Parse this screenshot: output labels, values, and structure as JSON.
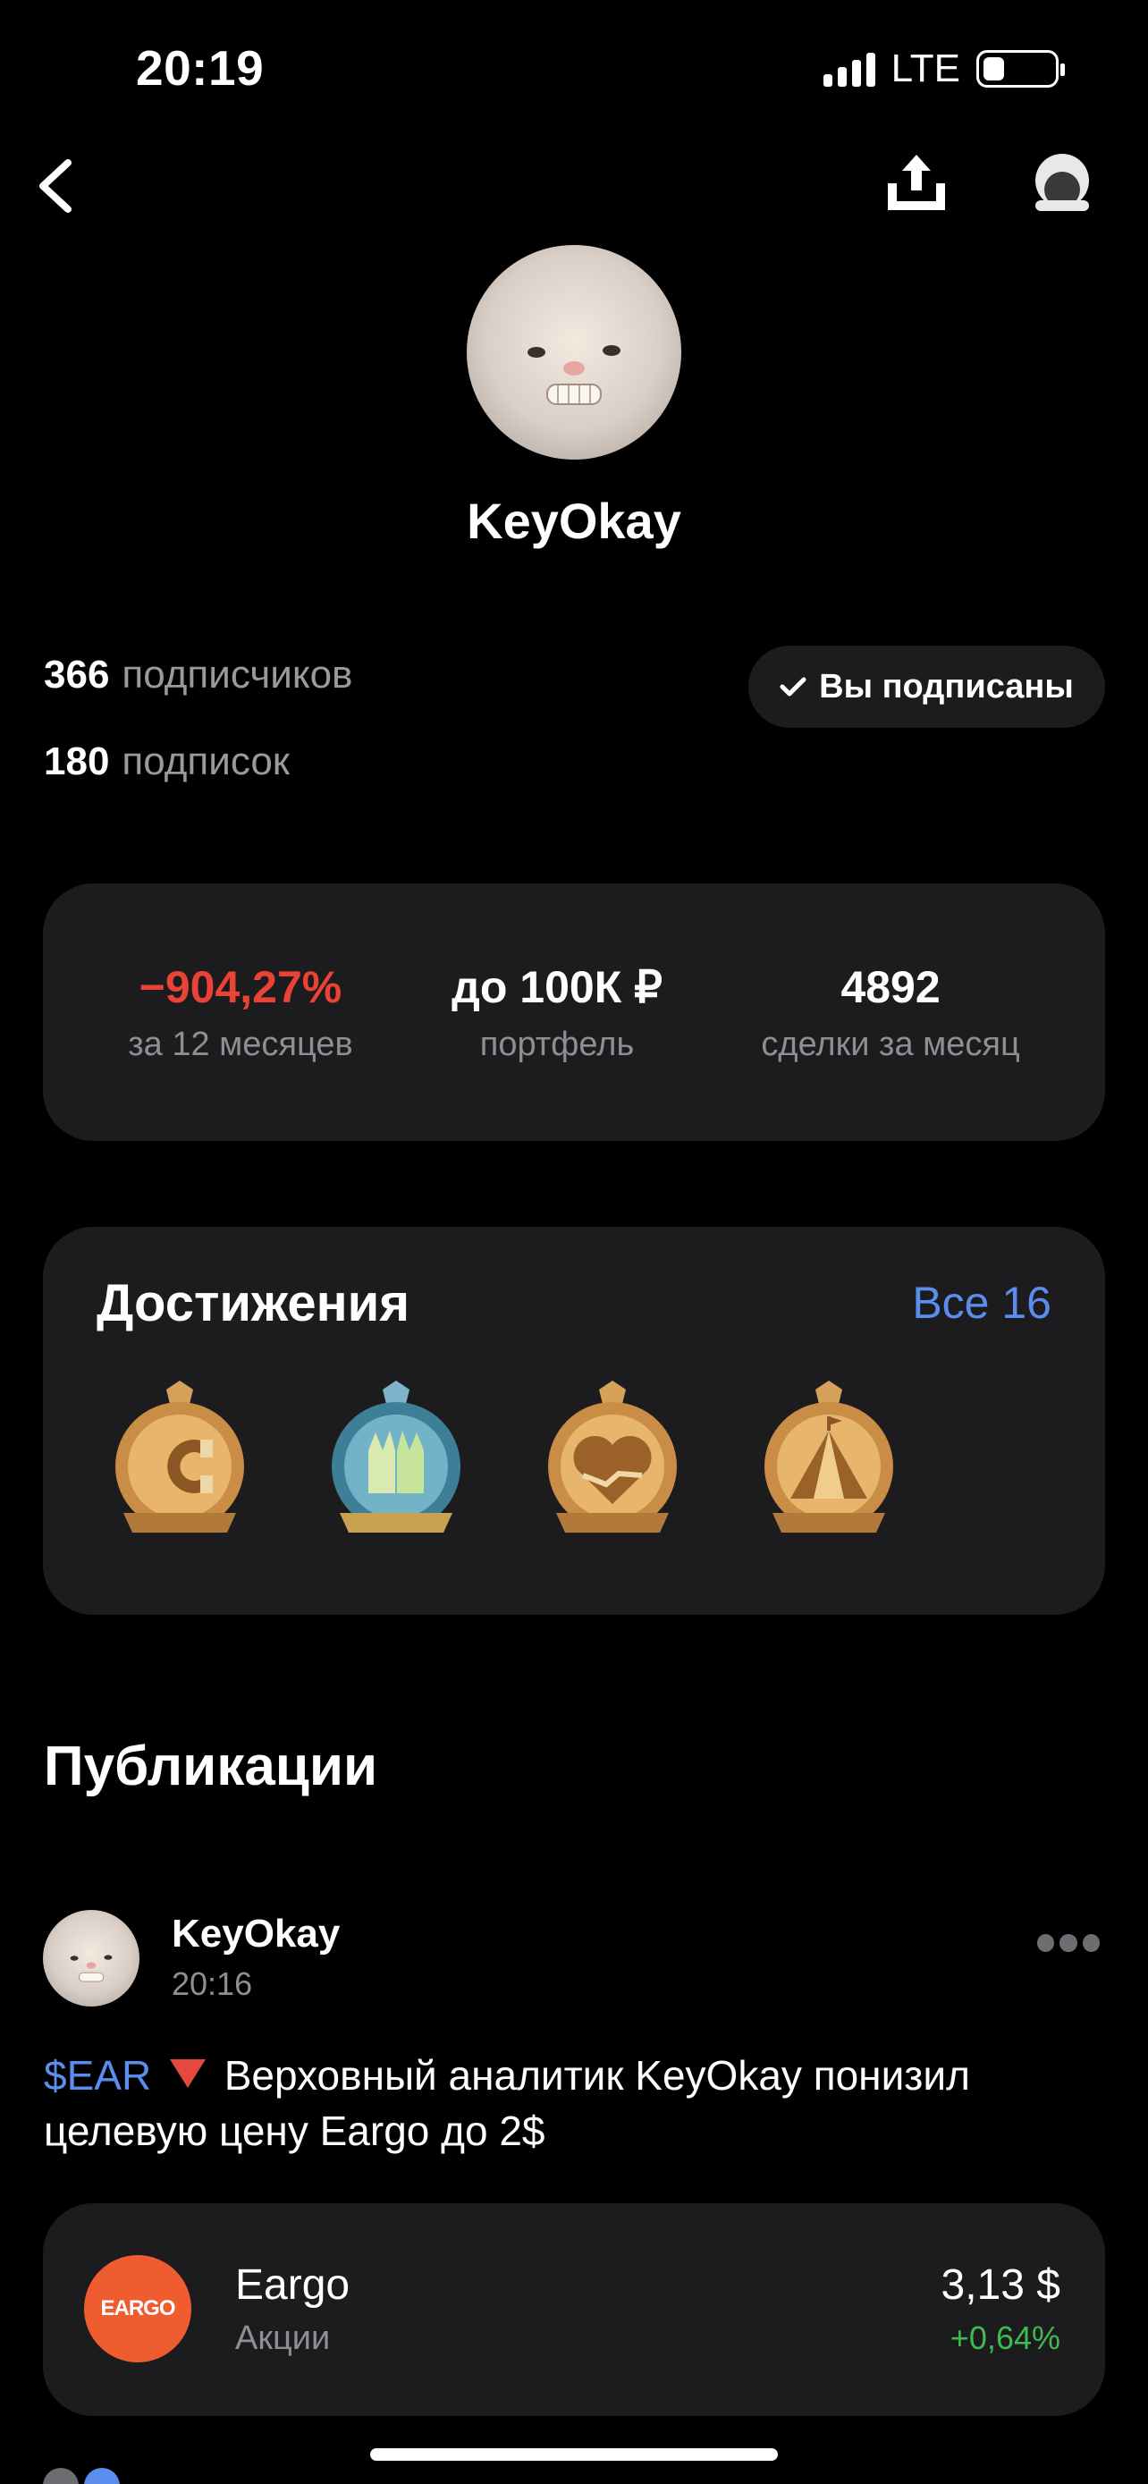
{
  "status_bar": {
    "time": "20:19",
    "network": "LTE"
  },
  "profile": {
    "username": "KeyOkay",
    "followers_count": "366",
    "followers_label": "подписчиков",
    "following_count": "180",
    "following_label": "подписок",
    "subscribe_button": "Вы подписаны"
  },
  "stats": [
    {
      "value": "−904,27%",
      "label": "за 12 месяцев"
    },
    {
      "value": "до 100К ₽",
      "label": "портфель"
    },
    {
      "value": "4892",
      "label": "сделки за месяц"
    }
  ],
  "achievements": {
    "title": "Достижения",
    "all_link": "Все 16",
    "badges": [
      "magnet-badge-icon",
      "gloves-badge-icon",
      "handshake-heart-badge-icon",
      "pyramid-badge-icon"
    ]
  },
  "publications": {
    "title": "Публикации",
    "post": {
      "author": "KeyOkay",
      "time": "20:16",
      "ticker": "$EAR",
      "text": "Верховный аналитик KeyOkay понизил целевую цену Eargo до 2$",
      "instrument": {
        "logo_text": "EARGO",
        "name": "Eargo",
        "type": "Акции",
        "price": "3,13 $",
        "change": "+0,64%"
      }
    }
  },
  "colors": {
    "background": "#000000",
    "card": "#1c1c1e",
    "accent_blue": "#5b8def",
    "negative": "#ea4335",
    "positive": "#3fb950",
    "eargo_orange": "#ef5c30"
  }
}
